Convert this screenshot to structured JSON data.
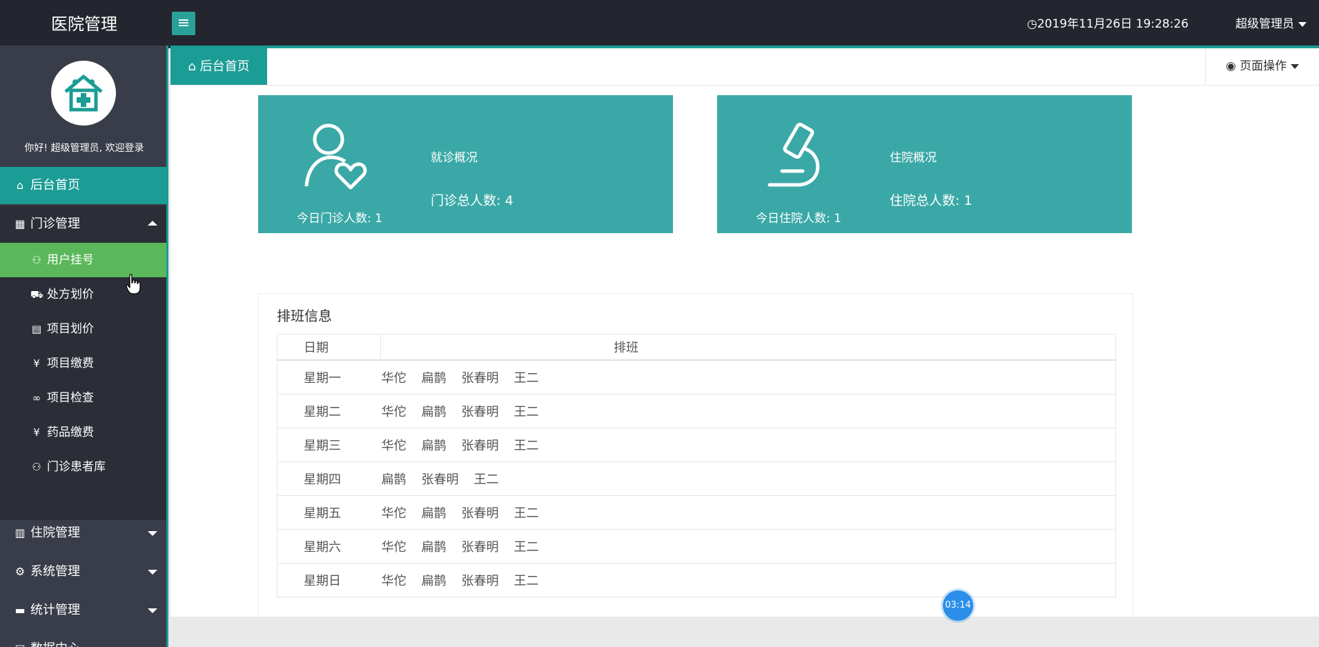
{
  "header": {
    "brand": "医院管理",
    "clock": "2019年11月26日 19:28:26",
    "user": "超级管理员"
  },
  "sidebar": {
    "welcome": "你好! 超级管理员, 欢迎登录",
    "home": "后台首页",
    "outpatient": {
      "label": "门诊管理",
      "items": [
        {
          "label": "用户挂号",
          "icon": "user-icon"
        },
        {
          "label": "处方划价",
          "icon": "cart-icon"
        },
        {
          "label": "项目划价",
          "icon": "document-icon"
        },
        {
          "label": "项目缴费",
          "icon": "yen-icon"
        },
        {
          "label": "项目检查",
          "icon": "infinity-icon"
        },
        {
          "label": "药品缴费",
          "icon": "yen-icon"
        },
        {
          "label": "门诊患者库",
          "icon": "user-icon"
        }
      ]
    },
    "groups": [
      {
        "label": "住院管理",
        "icon": "building-icon"
      },
      {
        "label": "系统管理",
        "icon": "gear-icon"
      },
      {
        "label": "统计管理",
        "icon": "monitor-icon"
      },
      {
        "label": "数据中心",
        "icon": "document-icon"
      }
    ]
  },
  "tabs": {
    "home": "后台首页",
    "page_ops": "页面操作"
  },
  "cards": {
    "outpatient": {
      "today": "今日门诊人数: 1",
      "title": "就诊概况",
      "total": "门诊总人数: 4"
    },
    "inpatient": {
      "today": "今日住院人数: 1",
      "title": "住院概况",
      "total": "住院总人数: 1"
    }
  },
  "schedule": {
    "title": "排班信息",
    "headers": [
      "日期",
      "排班"
    ],
    "rows": [
      {
        "day": "星期一",
        "doctors": [
          "华佗",
          "扁鹊",
          "张春明",
          "王二"
        ]
      },
      {
        "day": "星期二",
        "doctors": [
          "华佗",
          "扁鹊",
          "张春明",
          "王二"
        ]
      },
      {
        "day": "星期三",
        "doctors": [
          "华佗",
          "扁鹊",
          "张春明",
          "王二"
        ]
      },
      {
        "day": "星期四",
        "doctors": [
          "扁鹊",
          "张春明",
          "王二"
        ]
      },
      {
        "day": "星期五",
        "doctors": [
          "华佗",
          "扁鹊",
          "张春明",
          "王二"
        ]
      },
      {
        "day": "星期六",
        "doctors": [
          "华佗",
          "扁鹊",
          "张春明",
          "王二"
        ]
      },
      {
        "day": "星期日",
        "doctors": [
          "华佗",
          "扁鹊",
          "张春明",
          "王二"
        ]
      }
    ]
  },
  "timer": "03:14",
  "colors": {
    "topbar": "#23262e",
    "sidebar": "#393d49",
    "accent": "#1b9c95",
    "card": "#3aa8a6",
    "active_sub": "#5bb75b"
  }
}
